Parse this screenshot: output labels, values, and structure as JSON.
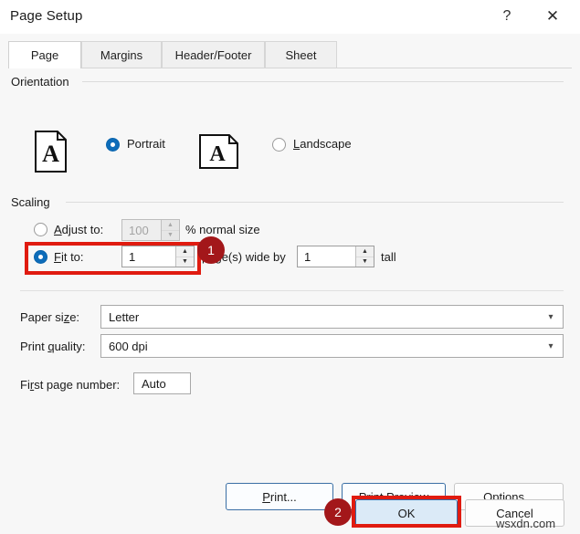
{
  "window": {
    "title": "Page Setup",
    "help_icon": "question-mark-icon",
    "close_icon": "close-x-icon"
  },
  "tabs": [
    {
      "label": "Page",
      "active": true
    },
    {
      "label": "Margins",
      "active": false
    },
    {
      "label": "Header/Footer",
      "active": false
    },
    {
      "label": "Sheet",
      "active": false
    }
  ],
  "orientation": {
    "group_label": "Orientation",
    "portrait": {
      "label": "Portrait",
      "selected": true,
      "icon": "portrait-page-icon"
    },
    "landscape": {
      "label": "Landscape",
      "selected": false,
      "icon": "landscape-page-icon"
    }
  },
  "scaling": {
    "group_label": "Scaling",
    "adjust_to": {
      "label": "Adjust to:",
      "selected": false,
      "value": "100",
      "suffix": "% normal size",
      "disabled": true
    },
    "fit_to": {
      "label": "Fit to:",
      "selected": true,
      "pages_wide_value": "1",
      "middle_label": "page(s) wide by",
      "pages_tall_value": "1",
      "suffix": "tall"
    }
  },
  "paper_size": {
    "label": "Paper size:",
    "value": "Letter"
  },
  "print_quality": {
    "label": "Print quality:",
    "value": "600 dpi"
  },
  "first_page_number": {
    "label": "First page number:",
    "value": "Auto"
  },
  "action_buttons": {
    "print": "Print...",
    "print_preview": "Print Preview",
    "options": "Options..."
  },
  "footer_buttons": {
    "ok": "OK",
    "cancel": "Cancel"
  },
  "annotations": {
    "badge_one": "1",
    "badge_two": "2",
    "highlight_color": "#e01b10",
    "badge_color": "#a3171a"
  },
  "watermark": {
    "text": "wsxdn.com"
  }
}
